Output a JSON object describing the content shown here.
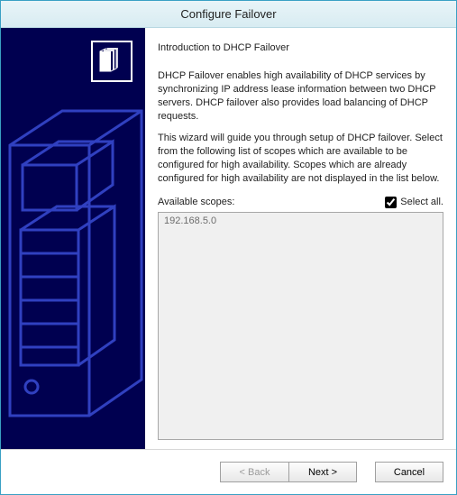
{
  "window": {
    "title": "Configure Failover"
  },
  "main": {
    "heading": "Introduction to DHCP Failover",
    "paragraph1": "DHCP Failover enables high availability of DHCP services by synchronizing IP address lease information between two DHCP servers. DHCP failover also provides load balancing of DHCP requests.",
    "paragraph2": "This wizard will guide you through setup of DHCP failover. Select from the following list of scopes which are available to be configured for high availability. Scopes which are already configured for high availability are not displayed in the list below.",
    "scopes_label": "Available scopes:",
    "select_all_label": "Select all.",
    "select_all_checked": true,
    "scopes": [
      "192.168.5.0"
    ]
  },
  "footer": {
    "back_label": "< Back",
    "next_label": "Next >",
    "cancel_label": "Cancel"
  }
}
